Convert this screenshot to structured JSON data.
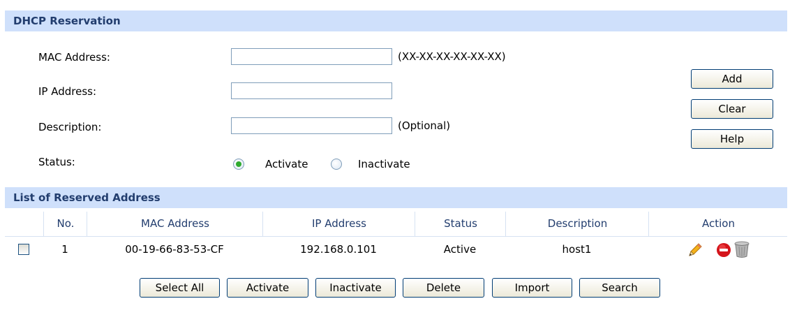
{
  "reservation": {
    "title": "DHCP Reservation",
    "mac_label": "MAC Address:",
    "mac_value": "",
    "mac_hint": "(XX-XX-XX-XX-XX-XX)",
    "ip_label": "IP Address:",
    "ip_value": "",
    "desc_label": "Description:",
    "desc_value": "",
    "desc_hint": "(Optional)",
    "status_label": "Status:",
    "status_options": [
      "Activate",
      "Inactivate"
    ],
    "status_selected": "Activate",
    "buttons": {
      "add": "Add",
      "clear": "Clear",
      "help": "Help"
    }
  },
  "list": {
    "title": "List of Reserved Address",
    "columns": [
      "No.",
      "MAC Address",
      "IP Address",
      "Status",
      "Description",
      "Action"
    ],
    "rows": [
      {
        "no": "1",
        "mac": "00-19-66-83-53-CF",
        "ip": "192.168.0.101",
        "status": "Active",
        "description": "host1",
        "checked": false
      }
    ],
    "action_icons": [
      "edit-pencil-icon",
      "delete-circle-icon",
      "trash-icon"
    ]
  },
  "toolbar": {
    "select_all": "Select All",
    "activate": "Activate",
    "inactivate": "Inactivate",
    "delete": "Delete",
    "import": "Import",
    "search": "Search"
  },
  "colors": {
    "header_bg": "#cfe0fb",
    "header_text": "#223d6e",
    "radio_selected": "#2faa2f"
  }
}
